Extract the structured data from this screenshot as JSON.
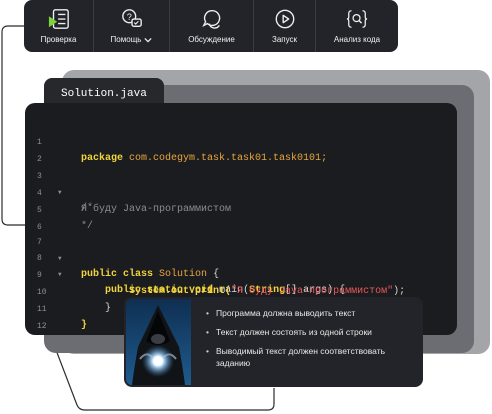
{
  "toolbar": {
    "items": [
      {
        "label": "Проверка",
        "icon": "check-list-icon"
      },
      {
        "label": "Помощь",
        "icon": "help-chat-icon",
        "dropdown": true
      },
      {
        "label": "Обсуждение",
        "icon": "discussion-icon"
      },
      {
        "label": "Запуск",
        "icon": "play-icon"
      },
      {
        "label": "Анализ кода",
        "icon": "code-analysis-icon"
      }
    ],
    "accent_color": "#7ed23d"
  },
  "editor": {
    "file_tab": "Solution.java",
    "lines": [
      {
        "n": "1"
      },
      {
        "n": "2"
      },
      {
        "n": "3"
      },
      {
        "n": "4"
      },
      {
        "n": "5"
      },
      {
        "n": "6"
      },
      {
        "n": "7"
      },
      {
        "n": "8"
      },
      {
        "n": "9"
      },
      {
        "n": "10"
      },
      {
        "n": "11"
      },
      {
        "n": "12"
      }
    ],
    "code": {
      "package_kw": "package",
      "package_name": "com.codegym.task.task01.task0101;",
      "comment_open": "/*",
      "comment_text": "Я буду Java-программистом",
      "comment_close": "*/",
      "class_kw": "public class",
      "class_name": "Solution",
      "class_brace": "{",
      "method_kw": "public static void",
      "method_sig": "main(",
      "method_type": "String",
      "method_args_rest": "[] args) {",
      "print_call": "System.out.print(",
      "print_string": "\"Я буду Java-программистом\"",
      "print_end": ");",
      "close_method": "}",
      "close_class": "}"
    }
  },
  "requirements": {
    "items": [
      "Программа должна выводить текст",
      "Текст должен состоять из одной строки",
      "Выводимый текст должен соответствовать заданию"
    ]
  }
}
